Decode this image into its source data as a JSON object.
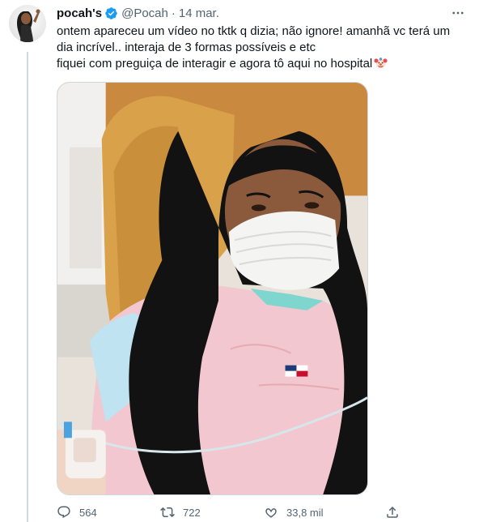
{
  "tweet": {
    "author_name": "pocah's",
    "handle": "@Pocah",
    "separator": "·",
    "date": "14 mar.",
    "text_line1": "ontem apareceu um vídeo no tktk q dizia; não ignore! amanhã vc terá um dia incrível.. interaja de 3 formas possíveis e etc",
    "text_line2": "fiquei com preguiça de interagir e agora tô aqui no hospital"
  },
  "icons": {
    "verified": "verified-badge-icon",
    "more": "more-options-icon",
    "reply": "reply-icon",
    "retweet": "retweet-icon",
    "like": "like-icon",
    "share": "share-icon",
    "emoji": "clown-face-emoji"
  },
  "stats": {
    "replies": "564",
    "retweets": "722",
    "likes": "33,8 mil"
  },
  "colors": {
    "accent": "#1d9bf0",
    "text": "#0f1419",
    "secondary": "#536471",
    "border": "#cfd9de"
  }
}
